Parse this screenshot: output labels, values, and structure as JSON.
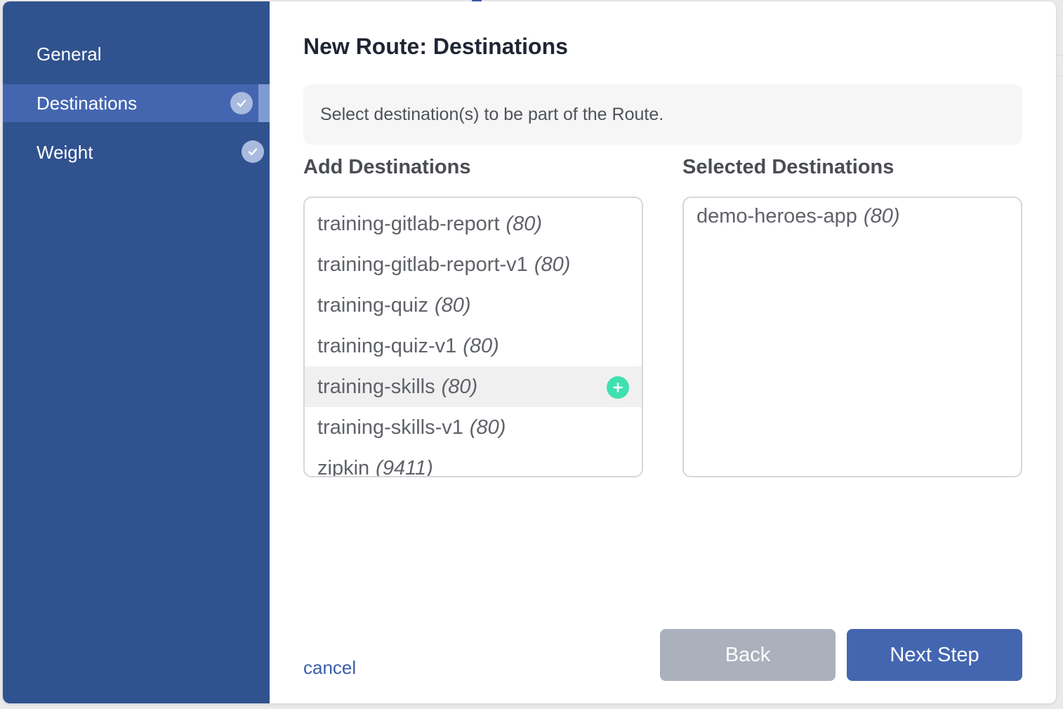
{
  "sidebar": {
    "items": [
      {
        "label": "General",
        "checked": false,
        "active": false
      },
      {
        "label": "Destinations",
        "checked": true,
        "active": true
      },
      {
        "label": "Weight",
        "checked": true,
        "active": false
      }
    ]
  },
  "main": {
    "title": "New Route: Destinations",
    "info": "Select destination(s) to be part of the Route.",
    "add_heading": "Add Destinations",
    "selected_heading": "Selected Destinations",
    "available": [
      {
        "name": "training-gitlab-report",
        "port": "(80)"
      },
      {
        "name": "training-gitlab-report-v1",
        "port": "(80)"
      },
      {
        "name": "training-quiz",
        "port": "(80)"
      },
      {
        "name": "training-quiz-v1",
        "port": "(80)"
      },
      {
        "name": "training-skills",
        "port": "(80)"
      },
      {
        "name": "training-skills-v1",
        "port": "(80)"
      },
      {
        "name": "zipkin",
        "port": "(9411)"
      }
    ],
    "selected": [
      {
        "name": "demo-heroes-app",
        "port": "(80)"
      }
    ]
  },
  "footer": {
    "cancel_label": "cancel",
    "back_label": "Back",
    "next_label": "Next Step"
  },
  "colors": {
    "sidebar_bg": "#30528f",
    "sidebar_active": "#4466b0",
    "primary_button": "#4466b0",
    "disabled_button": "#aab1bc",
    "add_icon": "#3fe0b0"
  },
  "icons": {
    "check": "check-circle-icon",
    "add": "plus-circle-icon"
  }
}
